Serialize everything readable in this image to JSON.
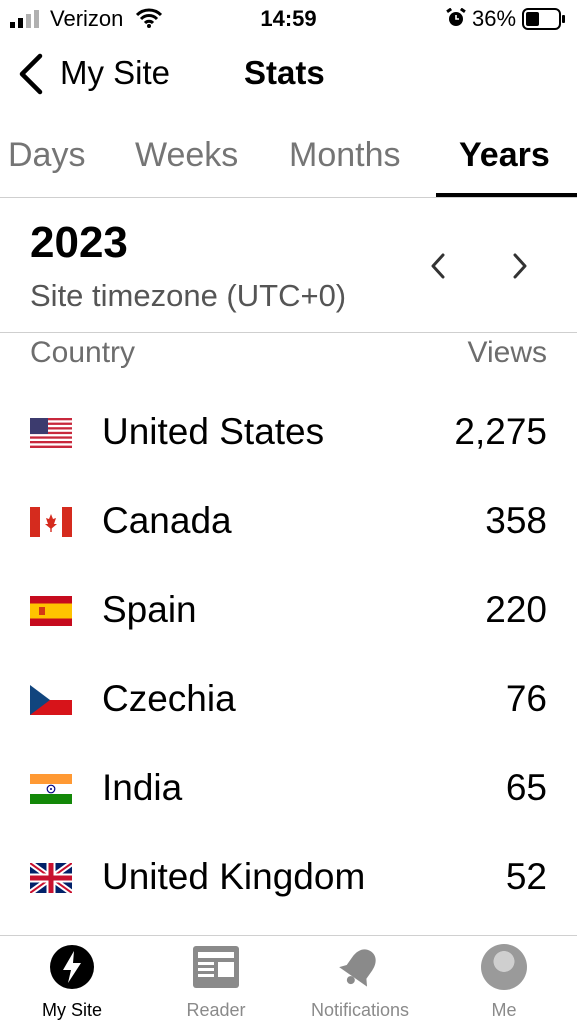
{
  "status_bar": {
    "carrier": "Verizon",
    "time": "14:59",
    "battery": "36%"
  },
  "nav": {
    "back_label": "My Site",
    "title": "Stats"
  },
  "tabs": [
    {
      "label": "Days"
    },
    {
      "label": "Weeks"
    },
    {
      "label": "Months"
    },
    {
      "label": "Years",
      "active": true
    }
  ],
  "period": {
    "year": "2023",
    "timezone": "Site timezone (UTC+0)"
  },
  "table": {
    "col_country": "Country",
    "col_views": "Views",
    "rows": [
      {
        "country": "United States",
        "views": "2,275",
        "flag": "us-flag"
      },
      {
        "country": "Canada",
        "views": "358",
        "flag": "ca-flag"
      },
      {
        "country": "Spain",
        "views": "220",
        "flag": "es-flag"
      },
      {
        "country": "Czechia",
        "views": "76",
        "flag": "cz-flag"
      },
      {
        "country": "India",
        "views": "65",
        "flag": "in-flag"
      },
      {
        "country": "United Kingdom",
        "views": "52",
        "flag": "gb-flag"
      }
    ]
  },
  "tab_bar": [
    {
      "label": "My Site",
      "icon": "wordpress-icon",
      "active": true
    },
    {
      "label": "Reader",
      "icon": "reader-icon"
    },
    {
      "label": "Notifications",
      "icon": "bell-icon"
    },
    {
      "label": "Me",
      "icon": "avatar"
    }
  ],
  "colors": {
    "accent": "#000000",
    "inactive": "#757575",
    "divider": "#cfcfcf"
  }
}
